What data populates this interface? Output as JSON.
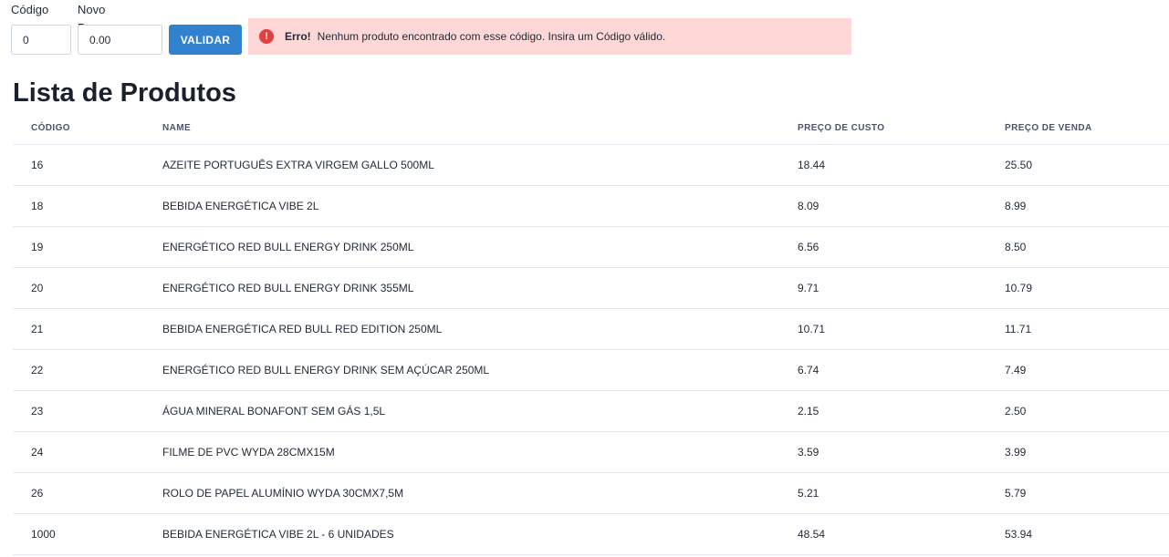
{
  "form": {
    "codigo_label": "Código",
    "codigo_value": "0",
    "preco_label": "Novo Preço",
    "preco_value": "0.00",
    "validar_label": "VALIDAR"
  },
  "alert": {
    "icon": "!",
    "title": "Erro!",
    "description": "Nenhum produto encontrado com esse código. Insira um Código válido.",
    "color": "#fed7d7",
    "icon_color": "#e53e3e"
  },
  "page_title": "Lista de Produtos",
  "table": {
    "headers": [
      "CÓDIGO",
      "NAME",
      "PREÇO DE CUSTO",
      "PREÇO DE VENDA"
    ],
    "rows": [
      [
        "16",
        "AZEITE PORTUGUÊS EXTRA VIRGEM GALLO 500ML",
        "18.44",
        "25.50"
      ],
      [
        "18",
        "BEBIDA ENERGÉTICA VIBE 2L",
        "8.09",
        "8.99"
      ],
      [
        "19",
        "ENERGÉTICO RED BULL ENERGY DRINK 250ML",
        "6.56",
        "8.50"
      ],
      [
        "20",
        "ENERGÉTICO RED BULL ENERGY DRINK 355ML",
        "9.71",
        "10.79"
      ],
      [
        "21",
        "BEBIDA ENERGÉTICA RED BULL RED EDITION 250ML",
        "10.71",
        "11.71"
      ],
      [
        "22",
        "ENERGÉTICO RED BULL ENERGY DRINK SEM AÇÚCAR 250ML",
        "6.74",
        "7.49"
      ],
      [
        "23",
        "ÁGUA MINERAL BONAFONT SEM GÁS 1,5L",
        "2.15",
        "2.50"
      ],
      [
        "24",
        "FILME DE PVC WYDA 28CMX15M",
        "3.59",
        "3.99"
      ],
      [
        "26",
        "ROLO DE PAPEL ALUMÍNIO WYDA 30CMX7,5M",
        "5.21",
        "5.79"
      ],
      [
        "1000",
        "BEBIDA ENERGÉTICA VIBE 2L - 6 UNIDADES",
        "48.54",
        "53.94"
      ]
    ]
  }
}
